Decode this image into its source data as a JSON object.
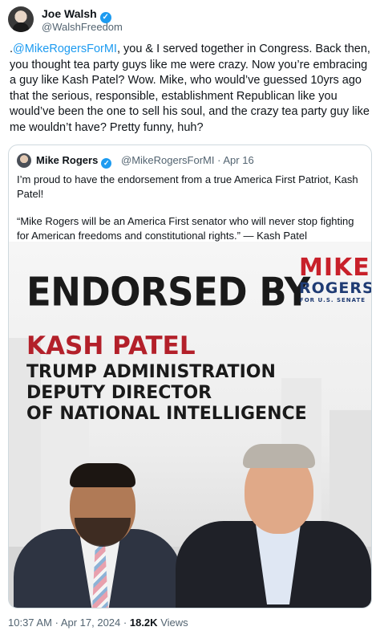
{
  "tweet": {
    "author_name": "Joe Walsh",
    "author_handle": "@WalshFreedom",
    "text_prefix": ".",
    "mention": "@MikeRogersForMI",
    "text_body": ", you & I served together in Congress. Back then, you thought tea party guys like me were crazy. Now you’re embracing a guy like Kash Patel? Wow. Mike, who would’ve guessed 10yrs ago that the serious, responsible, establishment Republican like you would’ve been the one to sell his soul, and the crazy tea party guy like me wouldn’t have? Pretty funny, huh?",
    "time": "10:37 AM",
    "date": "Apr 17, 2024",
    "views_count": "18.2K",
    "views_label": "Views",
    "separator": "·"
  },
  "quote": {
    "author_name": "Mike Rogers",
    "author_handle": "@MikeRogersForMI",
    "date": "Apr 16",
    "separator": "·",
    "paragraph1": "I’m proud to have the endorsement from a true America First Patriot, Kash Patel!",
    "paragraph2": "“Mike Rogers will be an America First senator who will never stop fighting for American freedoms and constitutional rights.” — Kash Patel",
    "image": {
      "headline": "ENDORSED BY",
      "endorser": "KASH PATEL",
      "title_lines": [
        "TRUMP ADMINISTRATION",
        "DEPUTY DIRECTOR",
        "OF NATIONAL INTELLIGENCE"
      ],
      "logo_line1": "MIKE",
      "logo_line2": "ROGERS",
      "logo_line3": "FOR U.S. SENATE"
    }
  },
  "icons": {
    "verified": "verified-badge-icon",
    "verified_glyph": "✓"
  },
  "colors": {
    "accent": "#1d9bf0",
    "text": "#0f1419",
    "muted": "#536471",
    "border": "#cfd9de",
    "headline_red": "#b3202a",
    "logo_blue": "#1f3b73"
  }
}
